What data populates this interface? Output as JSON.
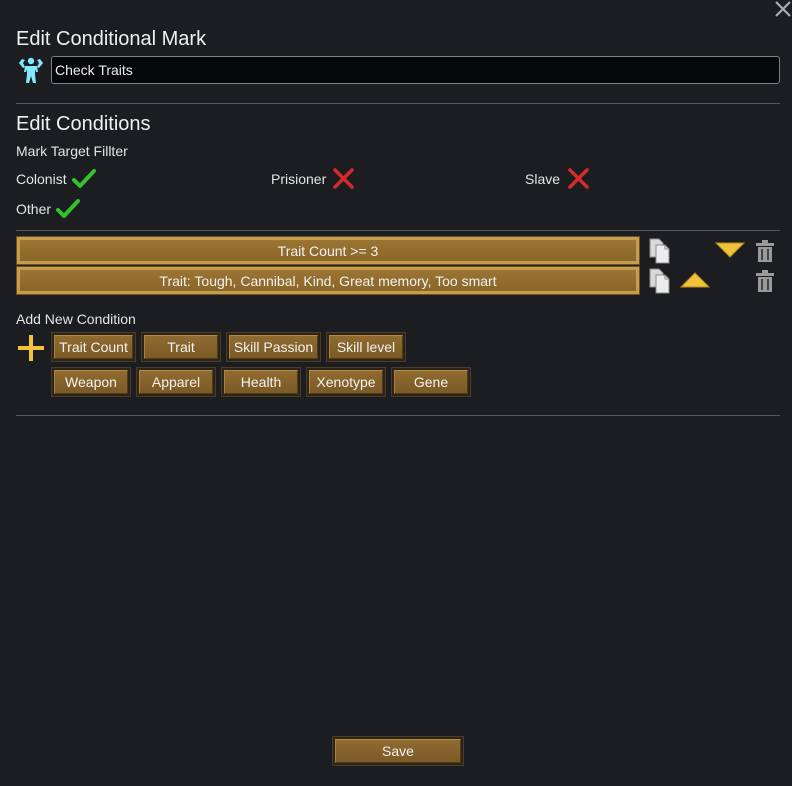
{
  "dialog": {
    "title": "Edit Conditional Mark",
    "close_icon": "close-icon"
  },
  "mark": {
    "icon": "strongman-icon",
    "name_value": "Check Traits"
  },
  "conditions_section": {
    "title": "Edit Conditions",
    "filter_label": "Mark Target Fillter",
    "filters": [
      {
        "label": "Colonist",
        "enabled": true
      },
      {
        "label": "Prisioner",
        "enabled": false
      },
      {
        "label": "Slave",
        "enabled": false
      },
      {
        "label": "Other",
        "enabled": true
      }
    ]
  },
  "conditions": [
    {
      "label": "Trait Count >= 3",
      "can_move_up": false,
      "can_move_down": true
    },
    {
      "label": "Trait: Tough, Cannibal, Kind, Great memory, Too smart",
      "can_move_up": true,
      "can_move_down": false
    }
  ],
  "add_condition": {
    "label": "Add New Condition",
    "buttons_row1": [
      "Trait Count",
      "Trait",
      "Skill Passion",
      "Skill level"
    ],
    "buttons_row2": [
      "Weapon",
      "Apparel",
      "Health",
      "Xenotype",
      "Gene"
    ]
  },
  "footer": {
    "save_label": "Save"
  },
  "colors": {
    "background": "#1b1d21",
    "accent_gold": "#f2c33a",
    "check_green": "#35c12b",
    "cross_red": "#d62b2b",
    "icon_cyan": "#7fe9ff"
  }
}
